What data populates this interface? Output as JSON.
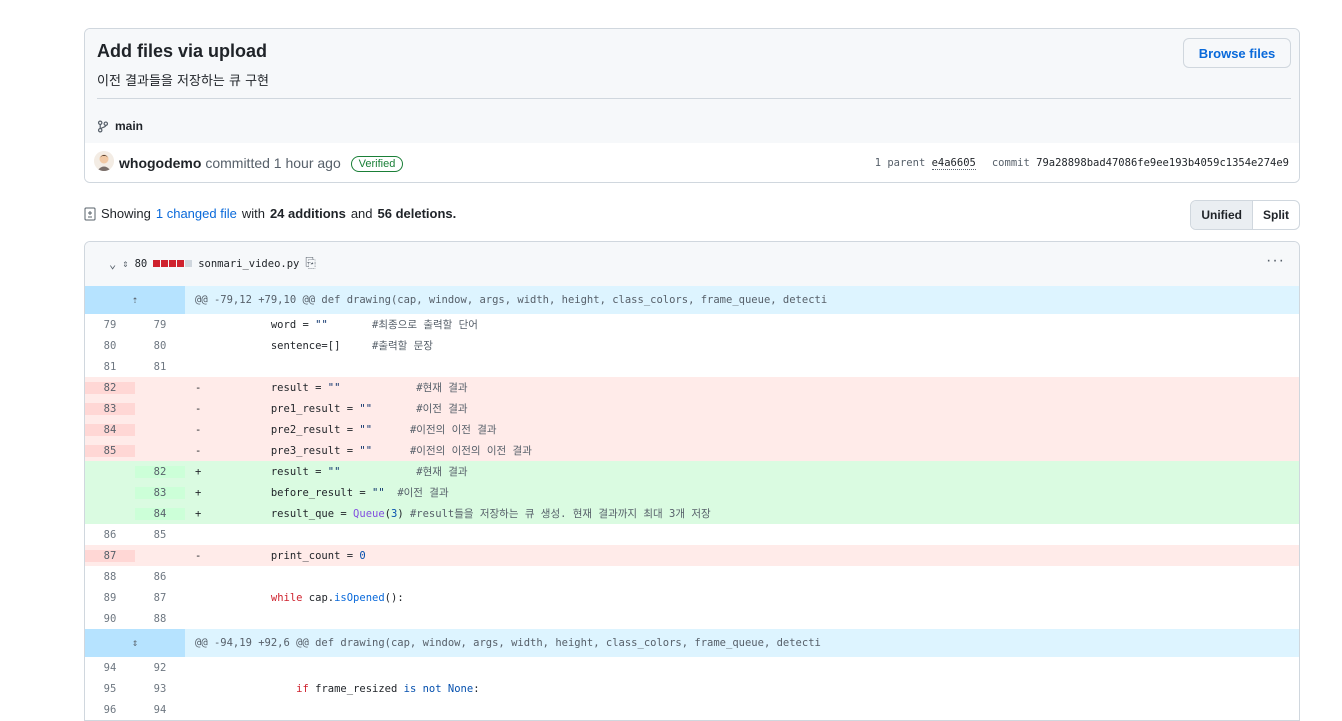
{
  "commit": {
    "title": "Add files via upload",
    "description": "이전 결과들을 저장하는 큐 구현",
    "browse_label": "Browse files",
    "branch": "main",
    "author": "whogodemo",
    "committed_text": "committed 1 hour ago",
    "verified_label": "Verified",
    "parent_label": "1 parent",
    "parent_sha": "e4a6605",
    "commit_label": "commit",
    "commit_sha": "79a28898bad47086fe9ee193b4059c1354e274e9"
  },
  "toc": {
    "showing": "Showing",
    "changed_link": "1 changed file",
    "with": "with",
    "additions": "24 additions",
    "and": "and",
    "deletions": "56 deletions.",
    "unified_label": "Unified",
    "split_label": "Split"
  },
  "file": {
    "change_count": "80",
    "filename": "sonmari_video.py",
    "diffstat_colors": [
      "#cf222e",
      "#cf222e",
      "#cf222e",
      "#cf222e",
      "#d0d7de"
    ],
    "more_label": "···"
  },
  "hunks": {
    "h1": "@@ -79,12 +79,10 @@ def drawing(cap, window, args, width, height, class_colors, frame_queue, detecti",
    "h2": "@@ -94,19 +92,6 @@ def drawing(cap, window, args, width, height, class_colors, frame_queue, detecti"
  },
  "lines": [
    {
      "old": "79",
      "new": "79",
      "type": "ctx",
      "sign": " ",
      "code": "        word = \"\"       #최종으로 출력할 단어"
    },
    {
      "old": "80",
      "new": "80",
      "type": "ctx",
      "sign": " ",
      "code": "        sentence=[]     #출력할 문장"
    },
    {
      "old": "81",
      "new": "81",
      "type": "ctx",
      "sign": " ",
      "code": ""
    },
    {
      "old": "82",
      "new": "",
      "type": "del",
      "sign": "-",
      "code": "        result = \"\"            #현재 결과"
    },
    {
      "old": "83",
      "new": "",
      "type": "del",
      "sign": "-",
      "code": "        pre1_result = \"\"       #이전 결과"
    },
    {
      "old": "84",
      "new": "",
      "type": "del",
      "sign": "-",
      "code": "        pre2_result = \"\"      #이전의 이전 결과"
    },
    {
      "old": "85",
      "new": "",
      "type": "del",
      "sign": "-",
      "code": "        pre3_result = \"\"      #이전의 이전의 이전 결과"
    },
    {
      "old": "",
      "new": "82",
      "type": "add",
      "sign": "+",
      "code": "        result = \"\"            #현재 결과"
    },
    {
      "old": "",
      "new": "83",
      "type": "add",
      "sign": "+",
      "code": "        before_result = \"\"  #이전 결과"
    },
    {
      "old": "",
      "new": "84",
      "type": "add",
      "sign": "+",
      "code": "        result_que = Queue(3) #result들을 저장하는 큐 생성. 현재 결과까지 최대 3개 저장"
    },
    {
      "old": "86",
      "new": "85",
      "type": "ctx",
      "sign": " ",
      "code": ""
    },
    {
      "old": "87",
      "new": "",
      "type": "del",
      "sign": "-",
      "code": "        print_count = 0"
    },
    {
      "old": "88",
      "new": "86",
      "type": "ctx",
      "sign": " ",
      "code": ""
    },
    {
      "old": "89",
      "new": "87",
      "type": "ctx",
      "sign": " ",
      "code": "        while cap.isOpened():"
    },
    {
      "old": "90",
      "new": "88",
      "type": "ctx",
      "sign": " ",
      "code": ""
    }
  ],
  "lines2": [
    {
      "old": "94",
      "new": "92",
      "type": "ctx",
      "sign": " ",
      "code": ""
    },
    {
      "old": "95",
      "new": "93",
      "type": "ctx",
      "sign": " ",
      "code": "            if frame_resized is not None:"
    },
    {
      "old": "96",
      "new": "94",
      "type": "ctx",
      "sign": " ",
      "code": ""
    }
  ]
}
